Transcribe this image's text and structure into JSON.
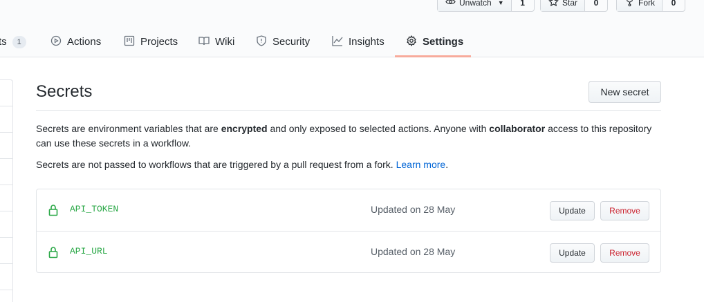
{
  "header": {
    "watch": {
      "label": "Unwatch",
      "count": "1"
    },
    "star": {
      "label": "Star",
      "count": "0"
    },
    "fork": {
      "label": "Fork",
      "count": "0"
    }
  },
  "tabs": [
    {
      "label": "ts",
      "counter": "1",
      "icon": "pull-request-icon"
    },
    {
      "label": "Actions",
      "icon": "play-icon"
    },
    {
      "label": "Projects",
      "icon": "project-icon"
    },
    {
      "label": "Wiki",
      "icon": "book-icon"
    },
    {
      "label": "Security",
      "icon": "shield-icon"
    },
    {
      "label": "Insights",
      "icon": "graph-icon"
    },
    {
      "label": "Settings",
      "icon": "gear-icon",
      "selected": true
    }
  ],
  "main": {
    "title": "Secrets",
    "new_secret_label": "New secret",
    "description": {
      "part1": "Secrets are environment variables that are ",
      "bold1": "encrypted",
      "part2": " and only exposed to selected actions. Anyone with ",
      "bold2": "collaborator",
      "part3": " access to this repository can use these secrets in a workflow."
    },
    "fork_note": {
      "text": "Secrets are not passed to workflows that are triggered by a pull request from a fork. ",
      "link": "Learn more",
      "end": "."
    },
    "secrets": [
      {
        "name": "API_TOKEN",
        "updated": "Updated on 28 May",
        "update_label": "Update",
        "remove_label": "Remove"
      },
      {
        "name": "API_URL",
        "updated": "Updated on 28 May",
        "update_label": "Update",
        "remove_label": "Remove"
      }
    ]
  },
  "colors": {
    "accent_underline": "#f9826c",
    "secret_name": "#28a745",
    "remove": "#cb2431",
    "link": "#0366d6"
  }
}
